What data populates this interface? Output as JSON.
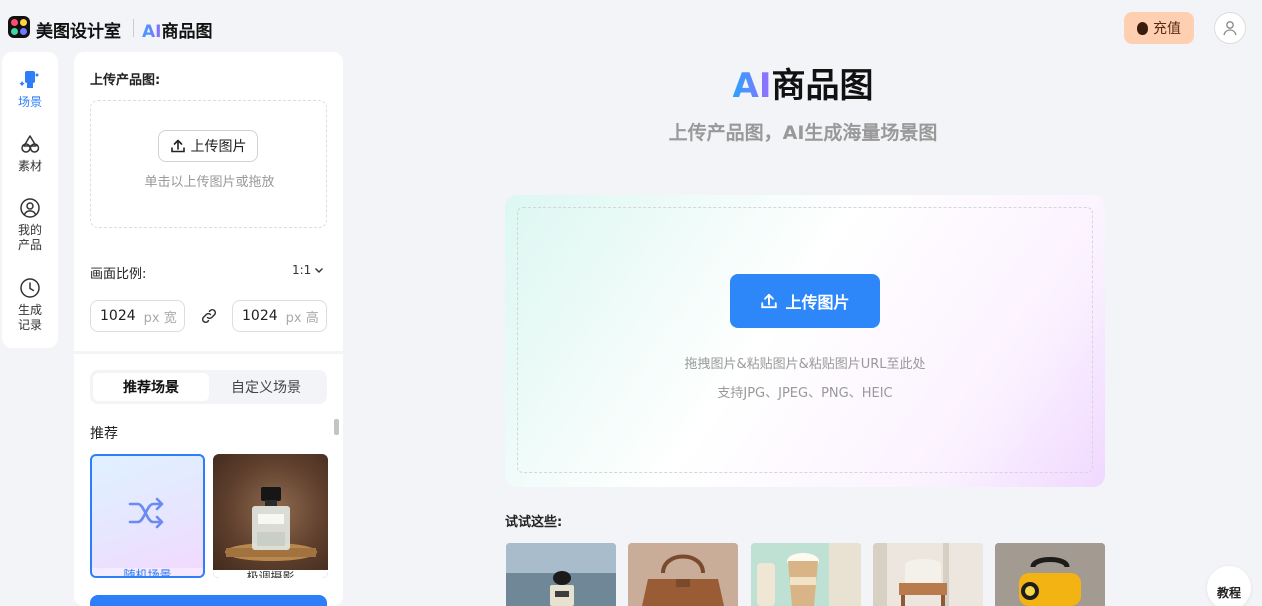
{
  "header": {
    "brand": "美图设计室",
    "product_prefix": "AI",
    "product_name": "商品图",
    "recharge_label": "充值"
  },
  "nav": {
    "items": [
      {
        "label": "场景",
        "icon": "scene-icon",
        "active": true
      },
      {
        "label": "素材",
        "icon": "material-icon",
        "active": false
      },
      {
        "label": "我的\n产品",
        "icon": "my-product-icon",
        "active": false
      },
      {
        "label": "生成\n记录",
        "icon": "history-icon",
        "active": false
      }
    ]
  },
  "panel": {
    "upload_label": "上传产品图:",
    "upload_button": "上传图片",
    "upload_hint": "单击以上传图片或拖放",
    "ratio_label": "画面比例:",
    "ratio_value": "1:1",
    "width_value": "1024",
    "width_unit": "px 宽",
    "height_value": "1024",
    "height_unit": "px 高",
    "tabs": [
      {
        "label": "推荐场景",
        "active": true
      },
      {
        "label": "自定义场景",
        "active": false
      }
    ],
    "section_label": "推荐",
    "cards": [
      {
        "label": "随机场景"
      },
      {
        "label": "极调摄影"
      }
    ]
  },
  "main": {
    "title_prefix": "AI",
    "title": "商品图",
    "subtitle": "上传产品图，AI生成海量场景图",
    "upload_button": "上传图片",
    "drop_hint": "拖拽图片&粘贴图片&粘贴图片URL至此处",
    "formats_hint": "支持JPG、JPEG、PNG、HEIC",
    "try_label": "试试这些:",
    "tutorial_label": "教程"
  },
  "colors": {
    "accent": "#2d7ef8",
    "recharge_bg": "#ffcfb2"
  }
}
